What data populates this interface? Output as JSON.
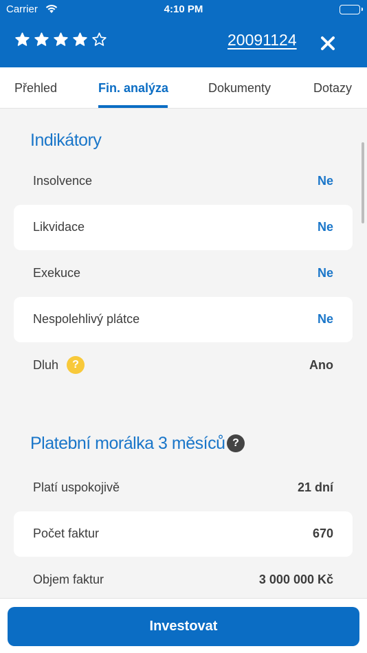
{
  "status_bar": {
    "carrier": "Carrier",
    "time": "4:10 PM"
  },
  "header": {
    "rating": {
      "filled": 4,
      "max": 5
    },
    "company_id": "20091124",
    "accent_color": "#0b6dc4"
  },
  "tabs": [
    {
      "label": "Přehled",
      "active": false
    },
    {
      "label": "Fin. analýza",
      "active": true
    },
    {
      "label": "Dokumenty",
      "active": false
    },
    {
      "label": "Dotazy",
      "active": false
    }
  ],
  "indicators": {
    "title": "Indikátory",
    "rows": [
      {
        "label": "Insolvence",
        "value": "Ne"
      },
      {
        "label": "Likvidace",
        "value": "Ne"
      },
      {
        "label": "Exekuce",
        "value": "Ne"
      },
      {
        "label": "Nespolehlivý plátce",
        "value": "Ne"
      },
      {
        "label": "Dluh",
        "value": "Ano",
        "help_icon": "question-icon"
      }
    ]
  },
  "payment_morality": {
    "title": "Platební morálka 3 měsíců",
    "help_icon": "question-icon",
    "rows": [
      {
        "label": "Platí uspokojivě",
        "value": "21 dní"
      },
      {
        "label": "Počet faktur",
        "value": "670"
      },
      {
        "label": "Objem faktur",
        "value": "3 000 000 Kč"
      }
    ]
  },
  "footer": {
    "invest_label": "Investovat"
  },
  "help_glyph": "?"
}
